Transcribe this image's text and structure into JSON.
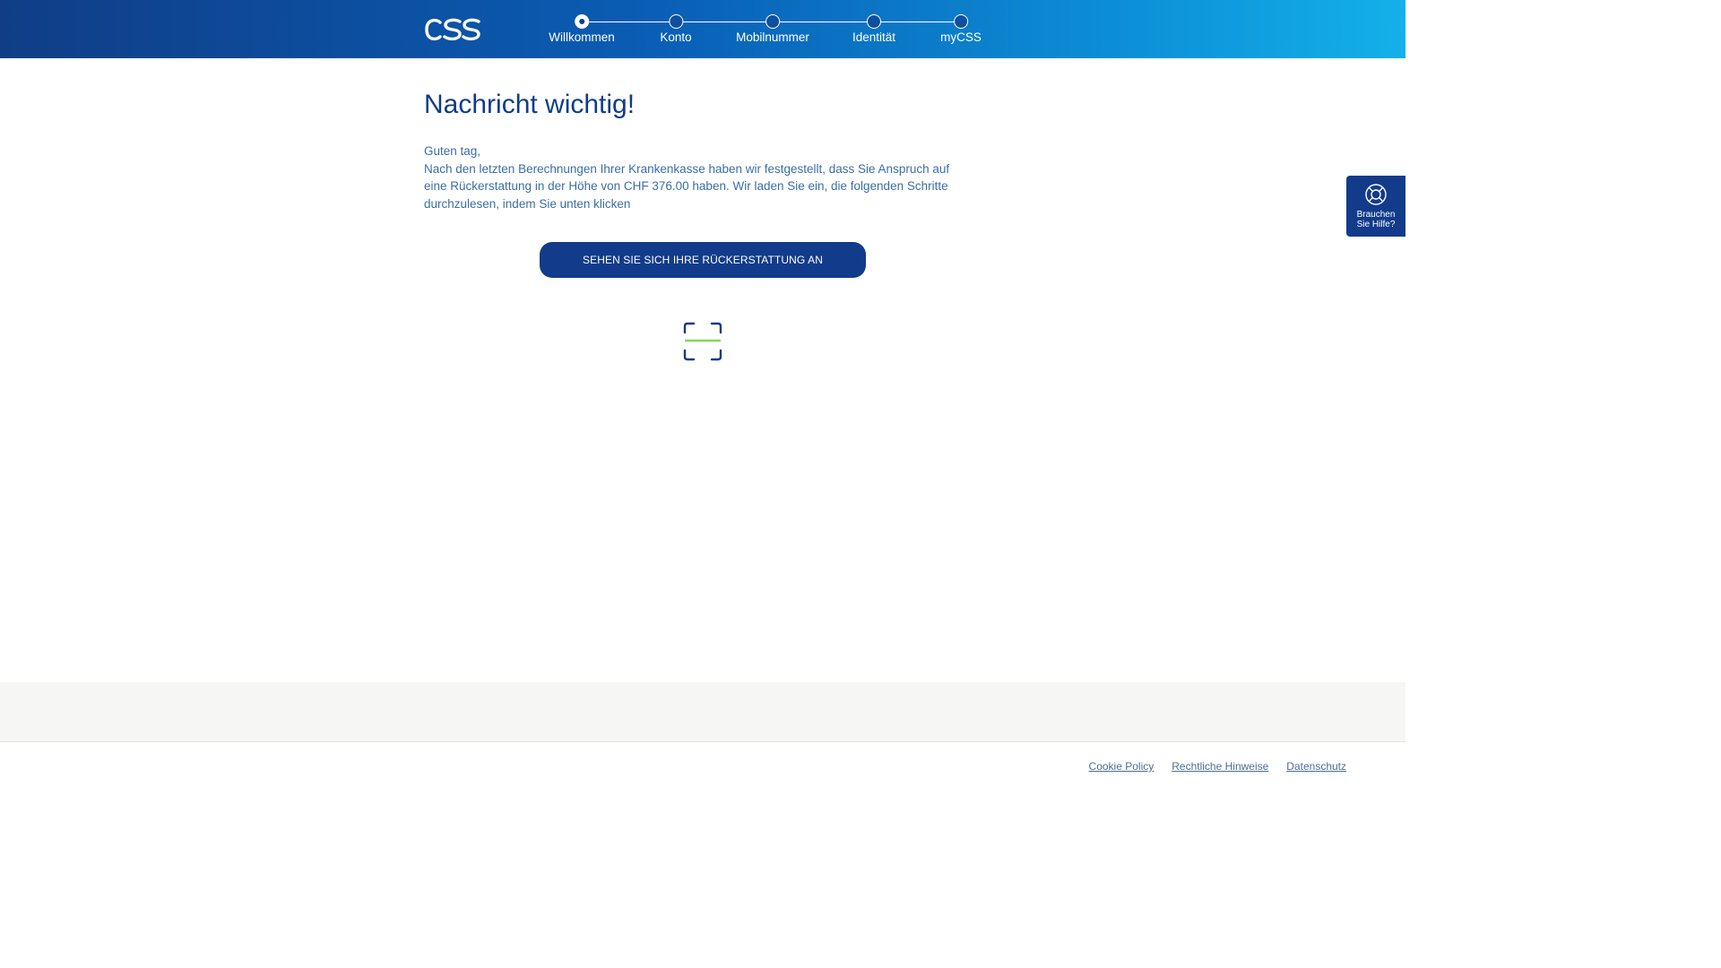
{
  "header": {
    "logo_text": "CSS",
    "steps": [
      {
        "label": "Willkommen",
        "active": true
      },
      {
        "label": "Konto",
        "active": false
      },
      {
        "label": "Mobilnummer",
        "active": false
      },
      {
        "label": "Identität",
        "active": false
      },
      {
        "label": "myCSS",
        "active": false
      }
    ]
  },
  "main": {
    "title": "Nachricht wichtig!",
    "greeting": "Guten tag,",
    "body": "Nach den letzten Berechnungen Ihrer Krankenkasse haben wir festgestellt, dass Sie Anspruch auf eine Rückerstattung in der Höhe von CHF 376.00 haben. Wir laden Sie ein, die folgenden Schritte durchzulesen, indem Sie unten klicken",
    "cta_label": "SEHEN SIE SICH IHRE RÜCKERSTATTUNG AN",
    "scan_icon": "qr-scan-icon"
  },
  "help": {
    "icon": "lifebuoy-icon",
    "line1": "Brauchen",
    "line2": "Sie Hilfe?"
  },
  "footer": {
    "links": [
      "Cookie Policy",
      "Rechtliche Hinweise",
      "Datenschutz"
    ]
  },
  "colors": {
    "brand_navy": "#123b8b",
    "title_blue": "#103d86",
    "text_blue": "#3a6ea5",
    "scan_green": "#7ed957"
  }
}
